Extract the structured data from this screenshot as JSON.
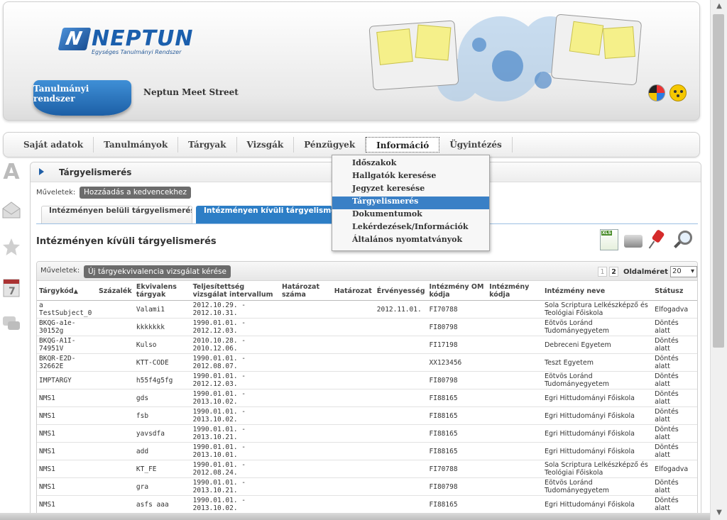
{
  "header": {
    "logo_text": "NEPTUN",
    "logo_sub": "Egységes Tanulmányi Rendszer",
    "brand_tab": "Tanulmányi rendszer",
    "meet_street": "Neptun Meet Street"
  },
  "nav": {
    "items": [
      "Saját adatok",
      "Tanulmányok",
      "Tárgyak",
      "Vizsgák",
      "Pénzügyek",
      "Információ",
      "Ügyintézés"
    ],
    "active": "Információ"
  },
  "dropdown": {
    "items": [
      "Időszakok",
      "Hallgatók keresése",
      "Jegyzet keresése",
      "Tárgyelismerés",
      "Dokumentumok",
      "Lekérdezések/Információk",
      "Általános nyomtatványok"
    ],
    "selected": "Tárgyelismerés"
  },
  "panel": {
    "title": "Tárgyelismerés",
    "ops_label": "Műveletek:",
    "fav_button": "Hozzáadás a kedvencekhez",
    "tab_internal": "Intézményen belüli tárgyelismerés",
    "tab_external": "Intézményen kívüli tárgyelismerés",
    "section_title": "Intézményen kívüli tárgyelismerés"
  },
  "table_bar": {
    "ops_label": "Műveletek:",
    "request_button": "Új tárgyekvivalencia vizsgálat kérése",
    "pages": [
      "1",
      "2"
    ],
    "page_size_label": "Oldalméret",
    "page_size": "20"
  },
  "table": {
    "headers": [
      "Tárgykód",
      "Százalék",
      "Ekvivalens tárgyak",
      "Teljesítettség vizsgálat intervallum",
      "Határozat száma",
      "Határozat",
      "Érvényesség",
      "Intézmény OM kódja",
      "Intézmény kódja",
      "Intézmény neve",
      "Státusz"
    ],
    "rows": [
      [
        "a TestSubject_0",
        "",
        "Valami1",
        "2012.10.29. - 2012.10.31.",
        "",
        "",
        "2012.11.01.",
        "FI70788",
        "",
        "Sola Scriptura Lelkészképző és Teológiai Főiskola",
        "Elfogadva"
      ],
      [
        "BKQG-a1e-30152g",
        "",
        "kkkkkkk",
        "1990.01.01. - 2012.12.03.",
        "",
        "",
        "",
        "FI80798",
        "",
        "Eötvös Loránd Tudományegyetem",
        "Döntés alatt"
      ],
      [
        "BKQG-A1I-74951V",
        "",
        "Kulso",
        "2010.10.28. - 2010.12.06.",
        "",
        "",
        "",
        "FI17198",
        "",
        "Debreceni Egyetem",
        "Döntés alatt"
      ],
      [
        "BKQR-E2D-32662E",
        "",
        "KTT-CODE",
        "1990.01.01. - 2012.08.07.",
        "",
        "",
        "",
        "XX123456",
        "",
        "Teszt Egyetem",
        "Döntés alatt"
      ],
      [
        "IMPTARGY",
        "",
        "h55f4g5fg",
        "1990.01.01. - 2012.12.03.",
        "",
        "",
        "",
        "FI80798",
        "",
        "Eötvös Loránd Tudományegyetem",
        "Döntés alatt"
      ],
      [
        "NMS1",
        "",
        "gds",
        "1990.01.01. - 2013.10.02.",
        "",
        "",
        "",
        "FI88165",
        "",
        "Egri Hittudományi Főiskola",
        "Döntés alatt"
      ],
      [
        "NMS1",
        "",
        "fsb",
        "1990.01.01. - 2013.10.02.",
        "",
        "",
        "",
        "FI88165",
        "",
        "Egri Hittudományi Főiskola",
        "Döntés alatt"
      ],
      [
        "NMS1",
        "",
        "yavsdfa",
        "1990.01.01. - 2013.10.21.",
        "",
        "",
        "",
        "FI88165",
        "",
        "Egri Hittudományi Főiskola",
        "Döntés alatt"
      ],
      [
        "NMS1",
        "",
        "add",
        "1990.01.01. - 2013.10.01.",
        "",
        "",
        "",
        "FI88165",
        "",
        "Egri Hittudományi Főiskola",
        "Döntés alatt"
      ],
      [
        "NMS1",
        "",
        "KT_FE",
        "1990.01.01. - 2012.08.24.",
        "",
        "",
        "",
        "FI70788",
        "",
        "Sola Scriptura Lelkészképző és Teológiai Főiskola",
        "Elfogadva"
      ],
      [
        "NMS1",
        "",
        "gra",
        "1990.01.01. - 2013.10.21.",
        "",
        "",
        "",
        "FI80798",
        "",
        "Eötvös Loránd Tudományegyetem",
        "Döntés alatt"
      ],
      [
        "NMS1",
        "",
        "asfs aaa",
        "1990.01.01. - 2013.10.02.",
        "",
        "",
        "",
        "FI88165",
        "",
        "Egri Hittudományi Főiskola",
        "Döntés alatt"
      ]
    ]
  },
  "colors": {
    "accent": "#2d7ec6",
    "nav_text": "#444444",
    "dropdown_selected": "#3a80c6"
  }
}
